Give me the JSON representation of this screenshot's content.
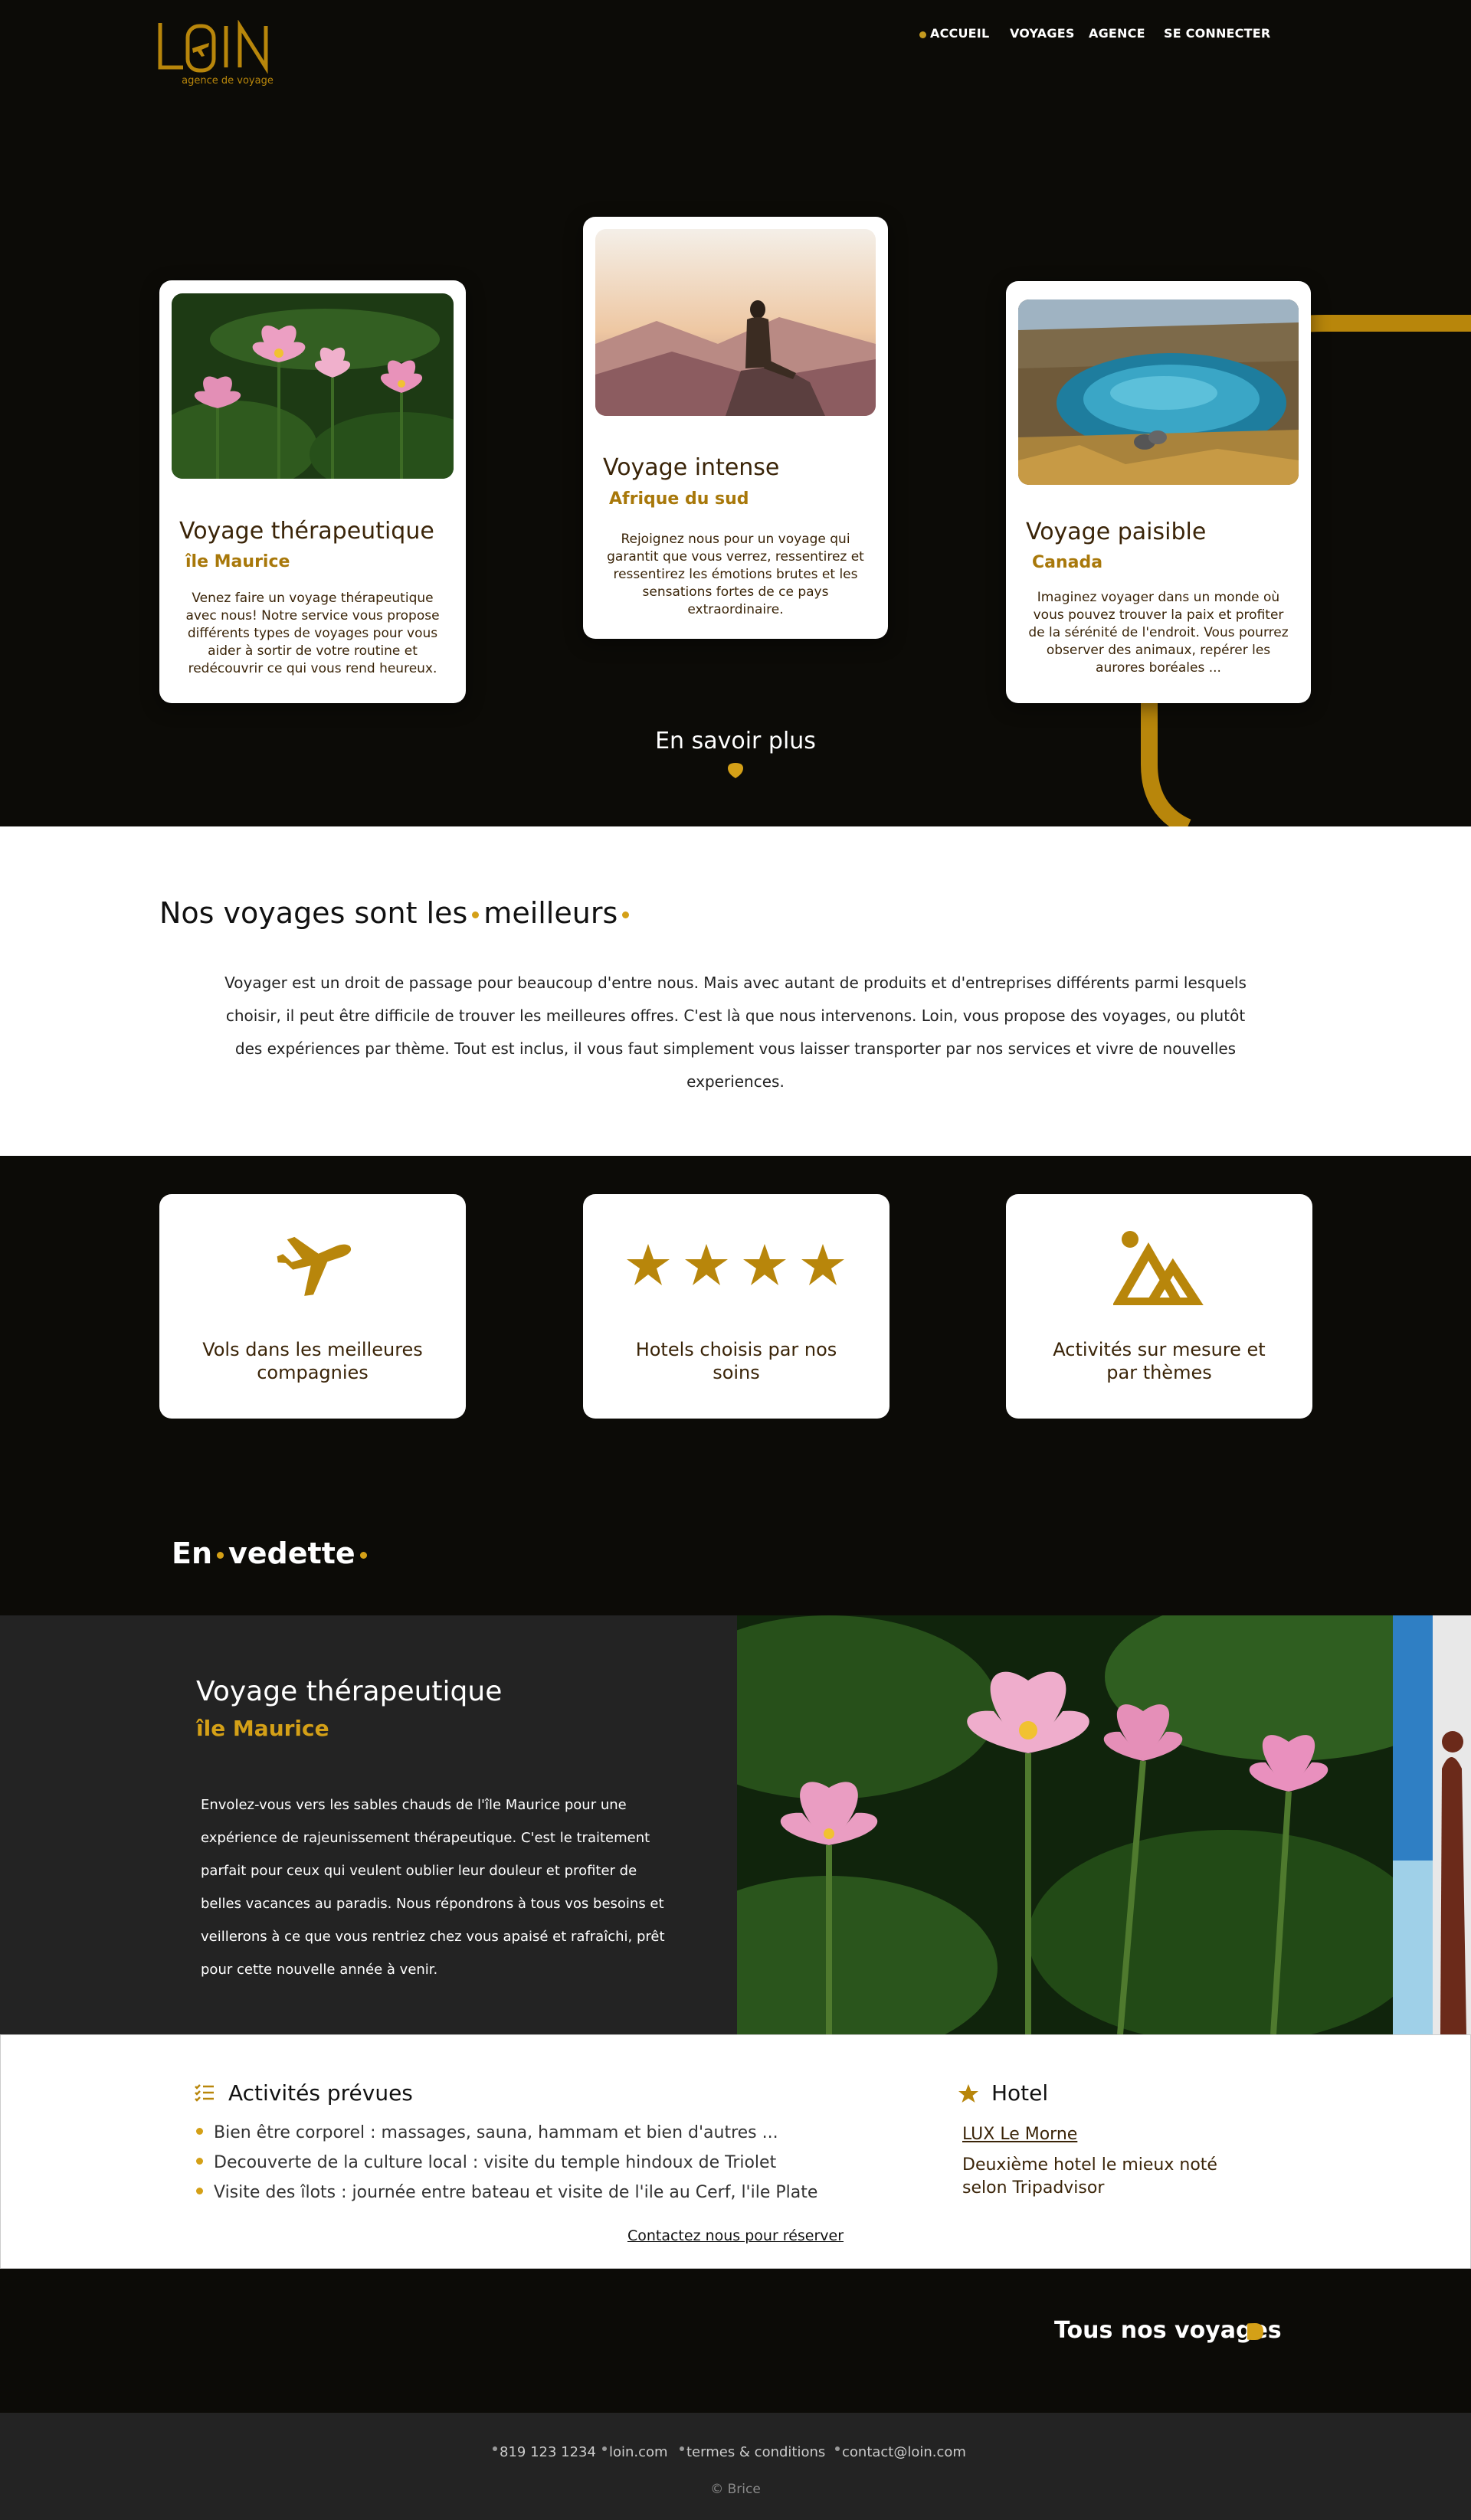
{
  "header": {
    "logo_text": "LOIN",
    "tagline": "agence de voyage",
    "nav": [
      "ACCUEIL",
      "VOYAGES",
      "AGENCE",
      "SE CONNECTER"
    ],
    "active_nav": "ACCUEIL"
  },
  "hero": {
    "cards": [
      {
        "title": "Voyage thérapeutique",
        "subtitle": "île Maurice",
        "description": "Venez faire un voyage thérapeutique avec nous! Notre service vous propose différents types de voyages pour vous aider à sortir de votre routine et redécouvrir ce qui vous rend heureux."
      },
      {
        "title": "Voyage intense",
        "subtitle": "Afrique du sud",
        "description": "Rejoignez nous pour un voyage qui garantit que vous verrez, ressentirez et ressentirez les émotions brutes et les sensations fortes de ce pays extraordinaire."
      },
      {
        "title": "Voyage paisible",
        "subtitle": "Canada",
        "description": "Imaginez voyager dans un monde où vous pouvez trouver la paix et profiter de la sérénité de l'endroit. Vous pourrez observer des animaux, repérer les aurores boréales ..."
      }
    ],
    "cta": "En savoir plus"
  },
  "intro": {
    "title_a": "Nos voyages sont les",
    "title_b": "meilleurs",
    "text": "Voyager est un droit de passage pour beaucoup d'entre nous. Mais avec autant de produits et d'entreprises différents parmi lesquels choisir, il peut être difficile de trouver les meilleures offres. C'est là que nous intervenons. Loin, vous propose des voyages, ou plutôt des expériences par thème. Tout est inclus, il vous faut simplement vous laisser transporter par nos services et vivre de nouvelles experiences."
  },
  "features": [
    {
      "label": "Vols dans les meilleures compagnies",
      "icon": "plane-icon"
    },
    {
      "label": "Hotels choisis par nos soins",
      "icon": "stars-icon"
    },
    {
      "label": "Activités sur mesure et par thèmes",
      "icon": "mountain-icon"
    }
  ],
  "vedette": {
    "title_a": "En",
    "title_b": "vedette",
    "title": "Voyage thérapeutique",
    "subtitle": "île Maurice",
    "text": "Envolez-vous vers les sables chauds de l'île Maurice pour une expérience de rajeunissement thérapeutique. C'est le traitement parfait pour ceux qui veulent oublier leur douleur et profiter de belles vacances au paradis. Nous répondrons à tous vos besoins et veillerons à ce que vous rentriez chez vous apaisé et rafraîchi, prêt pour cette nouvelle année à venir."
  },
  "details": {
    "activities_title": "Activités prévues",
    "activities": [
      "Bien être corporel :  massages, sauna, hammam et bien d'autres ...",
      "Decouverte de la culture local :  visite du temple hindoux de Triolet",
      "Visite des îlots :  journée entre bateau et visite de l'ile au Cerf, l'ile Plate"
    ],
    "hotel_title": "Hotel",
    "hotel_name": "LUX Le Morne",
    "hotel_desc": "Deuxième hotel le mieux noté selon Tripadvisor",
    "contact": "Contactez nous pour réserver"
  },
  "all_voyages": "Tous nos voyages",
  "footer": {
    "links": [
      "819 123 1234",
      "loin.com",
      "termes & conditions",
      "contact@loin.com"
    ],
    "copyright": "© Brice"
  },
  "colors": {
    "accent": "#d4a017",
    "dark": "#0c0b07",
    "panel": "#232323",
    "brown": "#3a2408"
  }
}
